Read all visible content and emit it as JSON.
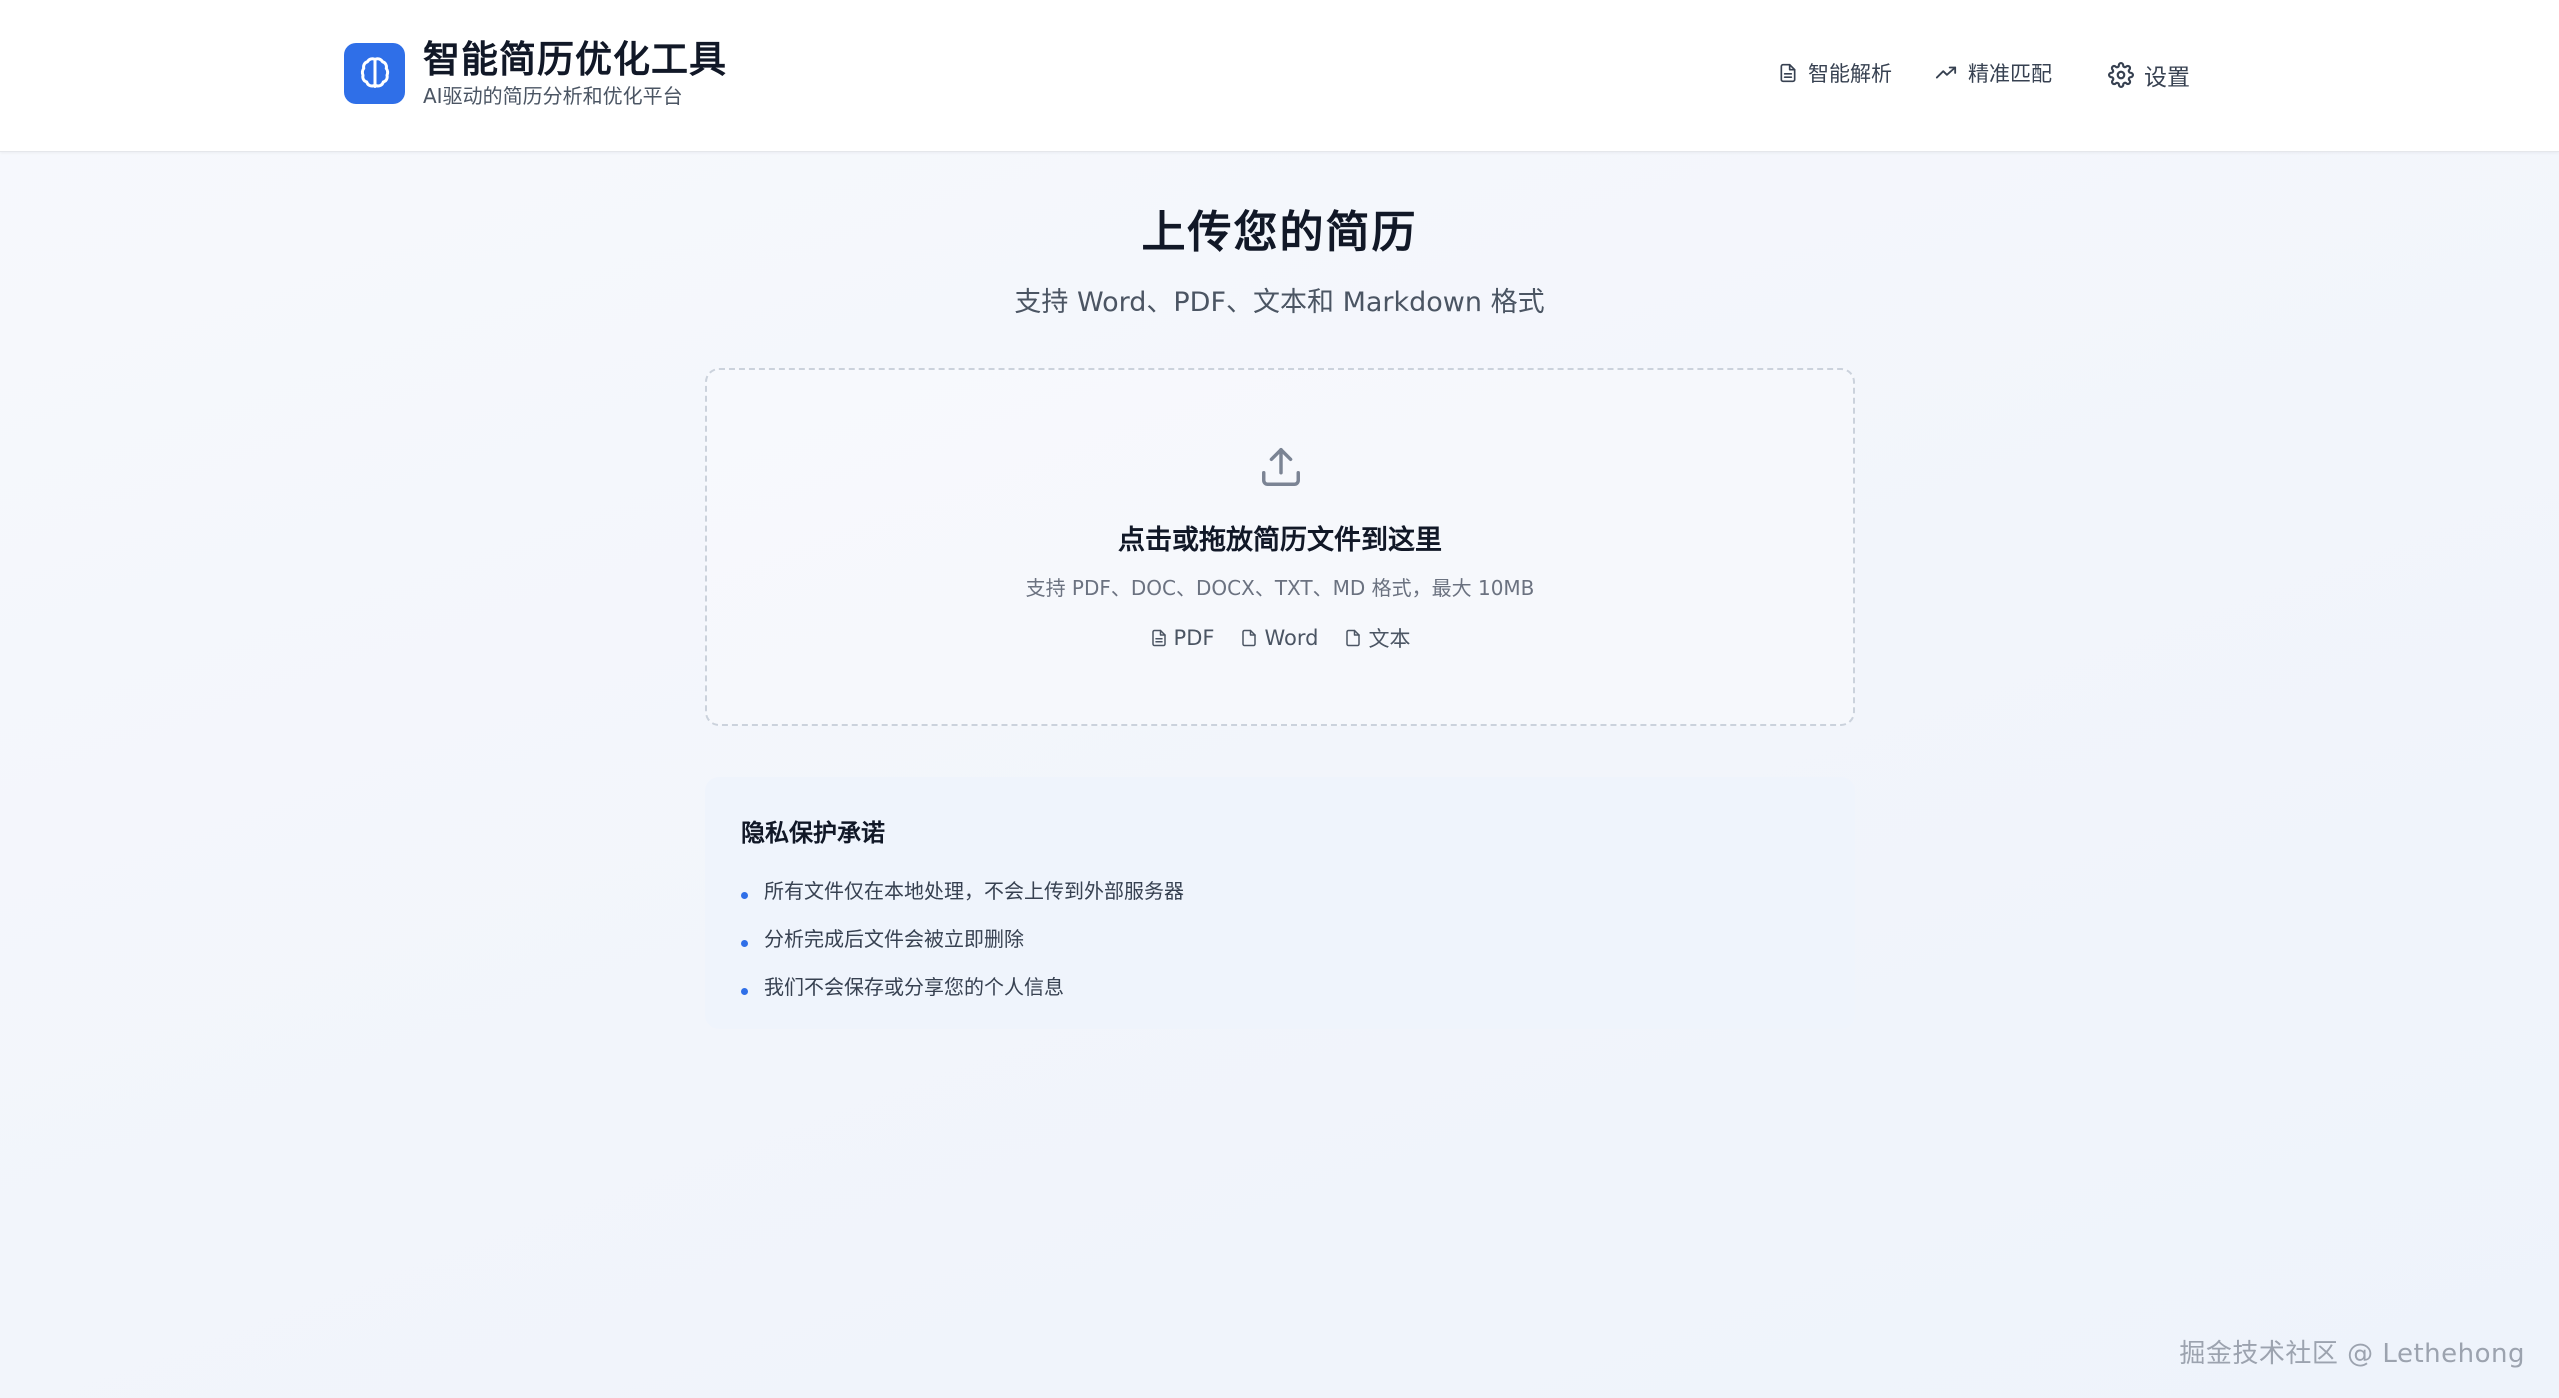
{
  "header": {
    "app_title": "智能简历优化工具",
    "app_subtitle": "AI驱动的简历分析和优化平台",
    "logo_icon": "brain-icon",
    "nav": {
      "parse": {
        "label": "智能解析",
        "icon": "document-icon"
      },
      "match": {
        "label": "精准匹配",
        "icon": "trending-up-icon"
      },
      "settings": {
        "label": "设置",
        "icon": "gear-icon"
      }
    }
  },
  "main": {
    "title": "上传您的简历",
    "subtitle": "支持 Word、PDF、文本和 Markdown 格式"
  },
  "upload": {
    "icon": "upload-icon",
    "title": "点击或拖放简历文件到这里",
    "hint": "支持 PDF、DOC、DOCX、TXT、MD 格式，最大 10MB",
    "formats": [
      {
        "label": "PDF",
        "icon": "file-text-icon"
      },
      {
        "label": "Word",
        "icon": "file-icon"
      },
      {
        "label": "文本",
        "icon": "file-icon"
      }
    ]
  },
  "privacy": {
    "title": "隐私保护承诺",
    "items": [
      "所有文件仅在本地处理，不会上传到外部服务器",
      "分析完成后文件会被立即删除",
      "我们不会保存或分享您的个人信息"
    ]
  },
  "watermark": "掘金技术社区 @ Lethehong",
  "colors": {
    "accent": "#2f6fe8",
    "text": "#111827",
    "muted": "#6b7280",
    "privacy_bg": "#eff4fc"
  }
}
